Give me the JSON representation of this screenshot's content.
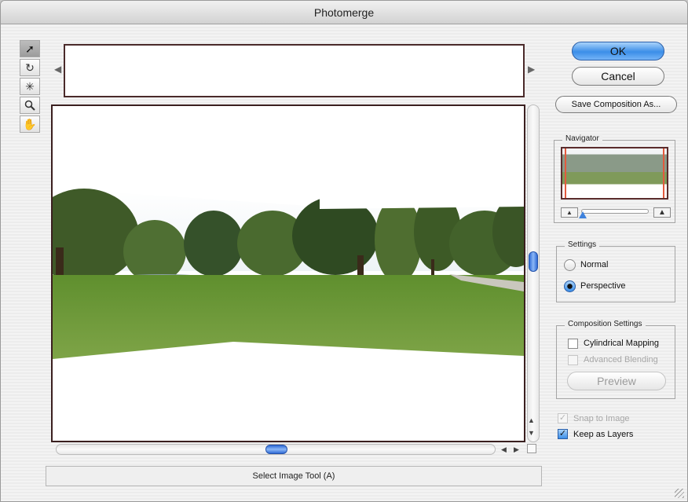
{
  "window": {
    "title": "Photomerge"
  },
  "tools": [
    {
      "name": "select-image-tool",
      "glyph": "➚"
    },
    {
      "name": "rotate-image-tool",
      "glyph": "↻"
    },
    {
      "name": "set-vanishing-point-tool",
      "glyph": "✳"
    },
    {
      "name": "zoom-tool",
      "glyph": "🔍"
    },
    {
      "name": "move-view-tool",
      "glyph": "✋"
    }
  ],
  "buttons": {
    "ok": "OK",
    "cancel": "Cancel",
    "save_composition": "Save Composition As...",
    "preview": "Preview"
  },
  "navigator": {
    "label": "Navigator"
  },
  "settings": {
    "label": "Settings",
    "normal": "Normal",
    "perspective": "Perspective",
    "selected": "Perspective"
  },
  "composition_settings": {
    "label": "Composition Settings",
    "cylindrical_mapping": "Cylindrical Mapping",
    "advanced_blending": "Advanced Blending"
  },
  "options": {
    "snap_to_image": "Snap to Image",
    "keep_as_layers": "Keep as Layers"
  },
  "status": {
    "text": "Select Image Tool (A)"
  },
  "colors": {
    "accent": "#3b8ee8",
    "frame": "#3a1f1f",
    "navigator_marker": "#e35a3e"
  }
}
